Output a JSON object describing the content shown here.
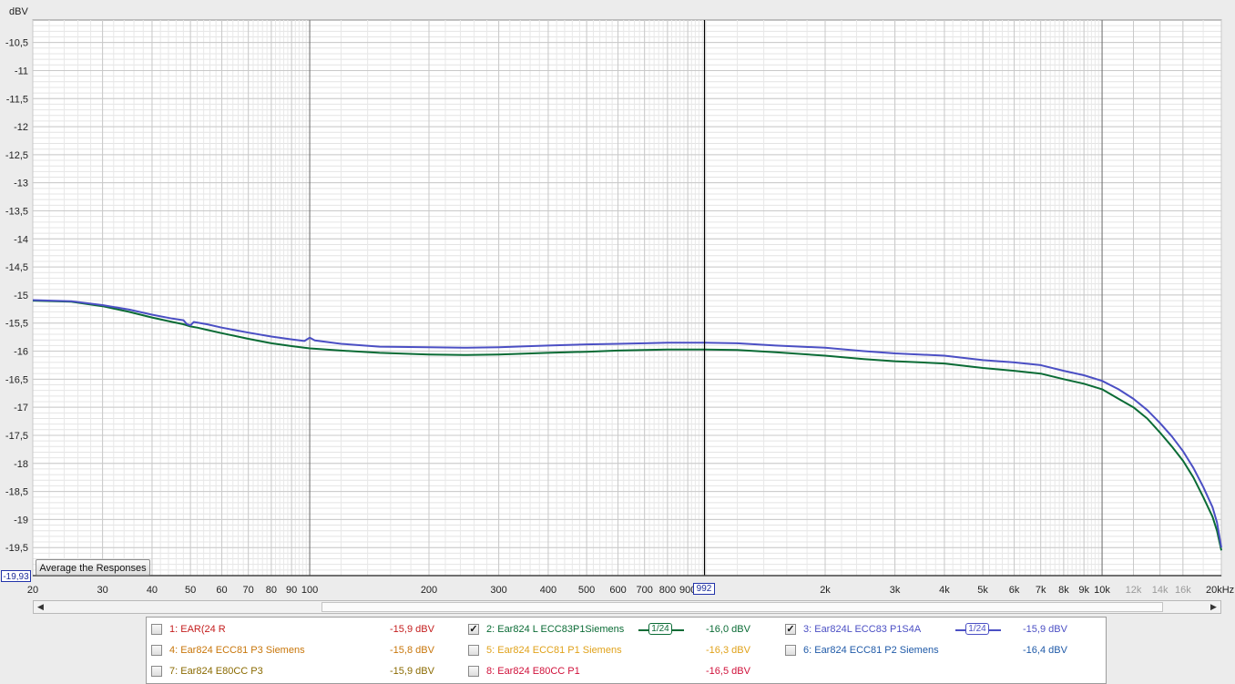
{
  "chart_data": {
    "type": "line",
    "ylabel": "dBV",
    "xunit": "kHz",
    "xscale": "log",
    "xlim": [
      20,
      20000
    ],
    "ylim": [
      -20.0,
      -10.1
    ],
    "grid": true,
    "cursor": {
      "x": 992,
      "x_label": "992",
      "y_label": "-19,93"
    },
    "y_ticks": [
      {
        "v": -10.5,
        "label": "-10,5"
      },
      {
        "v": -11,
        "label": "-11"
      },
      {
        "v": -11.5,
        "label": "-11,5"
      },
      {
        "v": -12,
        "label": "-12"
      },
      {
        "v": -12.5,
        "label": "-12,5"
      },
      {
        "v": -13,
        "label": "-13"
      },
      {
        "v": -13.5,
        "label": "-13,5"
      },
      {
        "v": -14,
        "label": "-14"
      },
      {
        "v": -14.5,
        "label": "-14,5"
      },
      {
        "v": -15,
        "label": "-15"
      },
      {
        "v": -15.5,
        "label": "-15,5"
      },
      {
        "v": -16,
        "label": "-16"
      },
      {
        "v": -16.5,
        "label": "-16,5"
      },
      {
        "v": -17,
        "label": "-17"
      },
      {
        "v": -17.5,
        "label": "-17,5"
      },
      {
        "v": -18,
        "label": "-18"
      },
      {
        "v": -18.5,
        "label": "-18,5"
      },
      {
        "v": -19,
        "label": "-19"
      },
      {
        "v": -19.5,
        "label": "-19,5"
      }
    ],
    "x_ticks": [
      {
        "v": 20,
        "label": "20"
      },
      {
        "v": 30,
        "label": "30"
      },
      {
        "v": 40,
        "label": "40"
      },
      {
        "v": 50,
        "label": "50"
      },
      {
        "v": 60,
        "label": "60"
      },
      {
        "v": 70,
        "label": "70"
      },
      {
        "v": 80,
        "label": "80"
      },
      {
        "v": 90,
        "label": "90"
      },
      {
        "v": 100,
        "label": "100"
      },
      {
        "v": 200,
        "label": "200"
      },
      {
        "v": 300,
        "label": "300"
      },
      {
        "v": 400,
        "label": "400"
      },
      {
        "v": 500,
        "label": "500"
      },
      {
        "v": 600,
        "label": "600"
      },
      {
        "v": 700,
        "label": "700"
      },
      {
        "v": 800,
        "label": "800"
      },
      {
        "v": 900,
        "label": "900"
      },
      {
        "v": 2000,
        "label": "2k"
      },
      {
        "v": 3000,
        "label": "3k"
      },
      {
        "v": 4000,
        "label": "4k"
      },
      {
        "v": 5000,
        "label": "5k"
      },
      {
        "v": 6000,
        "label": "6k"
      },
      {
        "v": 7000,
        "label": "7k"
      },
      {
        "v": 8000,
        "label": "8k"
      },
      {
        "v": 9000,
        "label": "9k"
      },
      {
        "v": 10000,
        "label": "10k"
      },
      {
        "v": 12000,
        "label": "12k",
        "light": true
      },
      {
        "v": 14000,
        "label": "14k",
        "light": true
      },
      {
        "v": 16000,
        "label": "16k",
        "light": true
      },
      {
        "v": 20000,
        "label": "20kHz"
      }
    ],
    "series": [
      {
        "name": "2: Ear824 L ECC83P1Siemens",
        "color": "#0a6b35",
        "points": [
          [
            20,
            -15.1
          ],
          [
            25,
            -15.12
          ],
          [
            30,
            -15.2
          ],
          [
            35,
            -15.3
          ],
          [
            40,
            -15.4
          ],
          [
            45,
            -15.48
          ],
          [
            48,
            -15.52
          ],
          [
            50,
            -15.56
          ],
          [
            52,
            -15.58
          ],
          [
            55,
            -15.62
          ],
          [
            60,
            -15.68
          ],
          [
            70,
            -15.78
          ],
          [
            80,
            -15.86
          ],
          [
            90,
            -15.91
          ],
          [
            100,
            -15.95
          ],
          [
            120,
            -15.99
          ],
          [
            150,
            -16.03
          ],
          [
            200,
            -16.06
          ],
          [
            250,
            -16.07
          ],
          [
            300,
            -16.06
          ],
          [
            400,
            -16.03
          ],
          [
            500,
            -16.01
          ],
          [
            600,
            -15.99
          ],
          [
            700,
            -15.98
          ],
          [
            800,
            -15.97
          ],
          [
            992,
            -15.97
          ],
          [
            1200,
            -15.98
          ],
          [
            1500,
            -16.02
          ],
          [
            2000,
            -16.08
          ],
          [
            2500,
            -16.14
          ],
          [
            3000,
            -16.18
          ],
          [
            4000,
            -16.22
          ],
          [
            5000,
            -16.3
          ],
          [
            6000,
            -16.35
          ],
          [
            7000,
            -16.4
          ],
          [
            8000,
            -16.5
          ],
          [
            9000,
            -16.58
          ],
          [
            10000,
            -16.68
          ],
          [
            11000,
            -16.85
          ],
          [
            12000,
            -17.0
          ],
          [
            13000,
            -17.2
          ],
          [
            14000,
            -17.45
          ],
          [
            15000,
            -17.7
          ],
          [
            16000,
            -17.95
          ],
          [
            17000,
            -18.25
          ],
          [
            18000,
            -18.6
          ],
          [
            19000,
            -18.95
          ],
          [
            19500,
            -19.2
          ],
          [
            20000,
            -19.55
          ]
        ]
      },
      {
        "name": "3: Ear824L ECC83 P1S4A",
        "color": "#4b4fc4",
        "points": [
          [
            20,
            -15.09
          ],
          [
            25,
            -15.11
          ],
          [
            30,
            -15.18
          ],
          [
            35,
            -15.26
          ],
          [
            40,
            -15.35
          ],
          [
            45,
            -15.42
          ],
          [
            48,
            -15.45
          ],
          [
            49,
            -15.52
          ],
          [
            50,
            -15.54
          ],
          [
            51,
            -15.48
          ],
          [
            55,
            -15.52
          ],
          [
            60,
            -15.58
          ],
          [
            70,
            -15.67
          ],
          [
            80,
            -15.74
          ],
          [
            90,
            -15.79
          ],
          [
            97,
            -15.82
          ],
          [
            100,
            -15.76
          ],
          [
            103,
            -15.81
          ],
          [
            120,
            -15.87
          ],
          [
            150,
            -15.92
          ],
          [
            200,
            -15.93
          ],
          [
            250,
            -15.94
          ],
          [
            300,
            -15.93
          ],
          [
            400,
            -15.9
          ],
          [
            500,
            -15.88
          ],
          [
            600,
            -15.87
          ],
          [
            700,
            -15.86
          ],
          [
            800,
            -15.85
          ],
          [
            992,
            -15.85
          ],
          [
            1200,
            -15.86
          ],
          [
            1500,
            -15.9
          ],
          [
            2000,
            -15.94
          ],
          [
            2500,
            -16.0
          ],
          [
            3000,
            -16.04
          ],
          [
            4000,
            -16.08
          ],
          [
            5000,
            -16.16
          ],
          [
            6000,
            -16.2
          ],
          [
            7000,
            -16.25
          ],
          [
            8000,
            -16.35
          ],
          [
            9000,
            -16.43
          ],
          [
            10000,
            -16.53
          ],
          [
            11000,
            -16.68
          ],
          [
            12000,
            -16.85
          ],
          [
            13000,
            -17.05
          ],
          [
            14000,
            -17.28
          ],
          [
            15000,
            -17.52
          ],
          [
            16000,
            -17.78
          ],
          [
            17000,
            -18.08
          ],
          [
            18000,
            -18.42
          ],
          [
            19000,
            -18.78
          ],
          [
            19500,
            -19.05
          ],
          [
            20000,
            -19.5
          ]
        ]
      }
    ]
  },
  "controls": {
    "average_button": "Average the Responses",
    "scroll_left": "◀",
    "scroll_right": "▶"
  },
  "legend": [
    {
      "label": "1: EAR(24 R",
      "value": "-15,9 dBV",
      "color": "#c41d1d",
      "checked": false
    },
    {
      "label": "2: Ear824 L ECC83P1Siemens",
      "value": "-16,0 dBV",
      "color": "#0a6b35",
      "checked": true,
      "smoothing": "1/24"
    },
    {
      "label": "3: Ear824L ECC83 P1S4A",
      "value": "-15,9 dBV",
      "color": "#4b4fc4",
      "checked": true,
      "smoothing": "1/24"
    },
    {
      "label": "4: Ear824 ECC81 P3 Siemens",
      "value": "-15,8 dBV",
      "color": "#c8760a",
      "checked": false
    },
    {
      "label": "5: Ear824 ECC81 P1 Siemens",
      "value": "-16,3 dBV",
      "color": "#e0a21a",
      "checked": false
    },
    {
      "label": "6: Ear824 ECC81 P2 Siemens",
      "value": "-16,4 dBV",
      "color": "#1f5aa8",
      "checked": false
    },
    {
      "label": "7: Ear824 E80CC P3",
      "value": "-15,9 dBV",
      "color": "#8a6a00",
      "checked": false
    },
    {
      "label": "8: Ear824 E80CC P1",
      "value": "-16,5 dBV",
      "color": "#d0103a",
      "checked": false
    }
  ]
}
